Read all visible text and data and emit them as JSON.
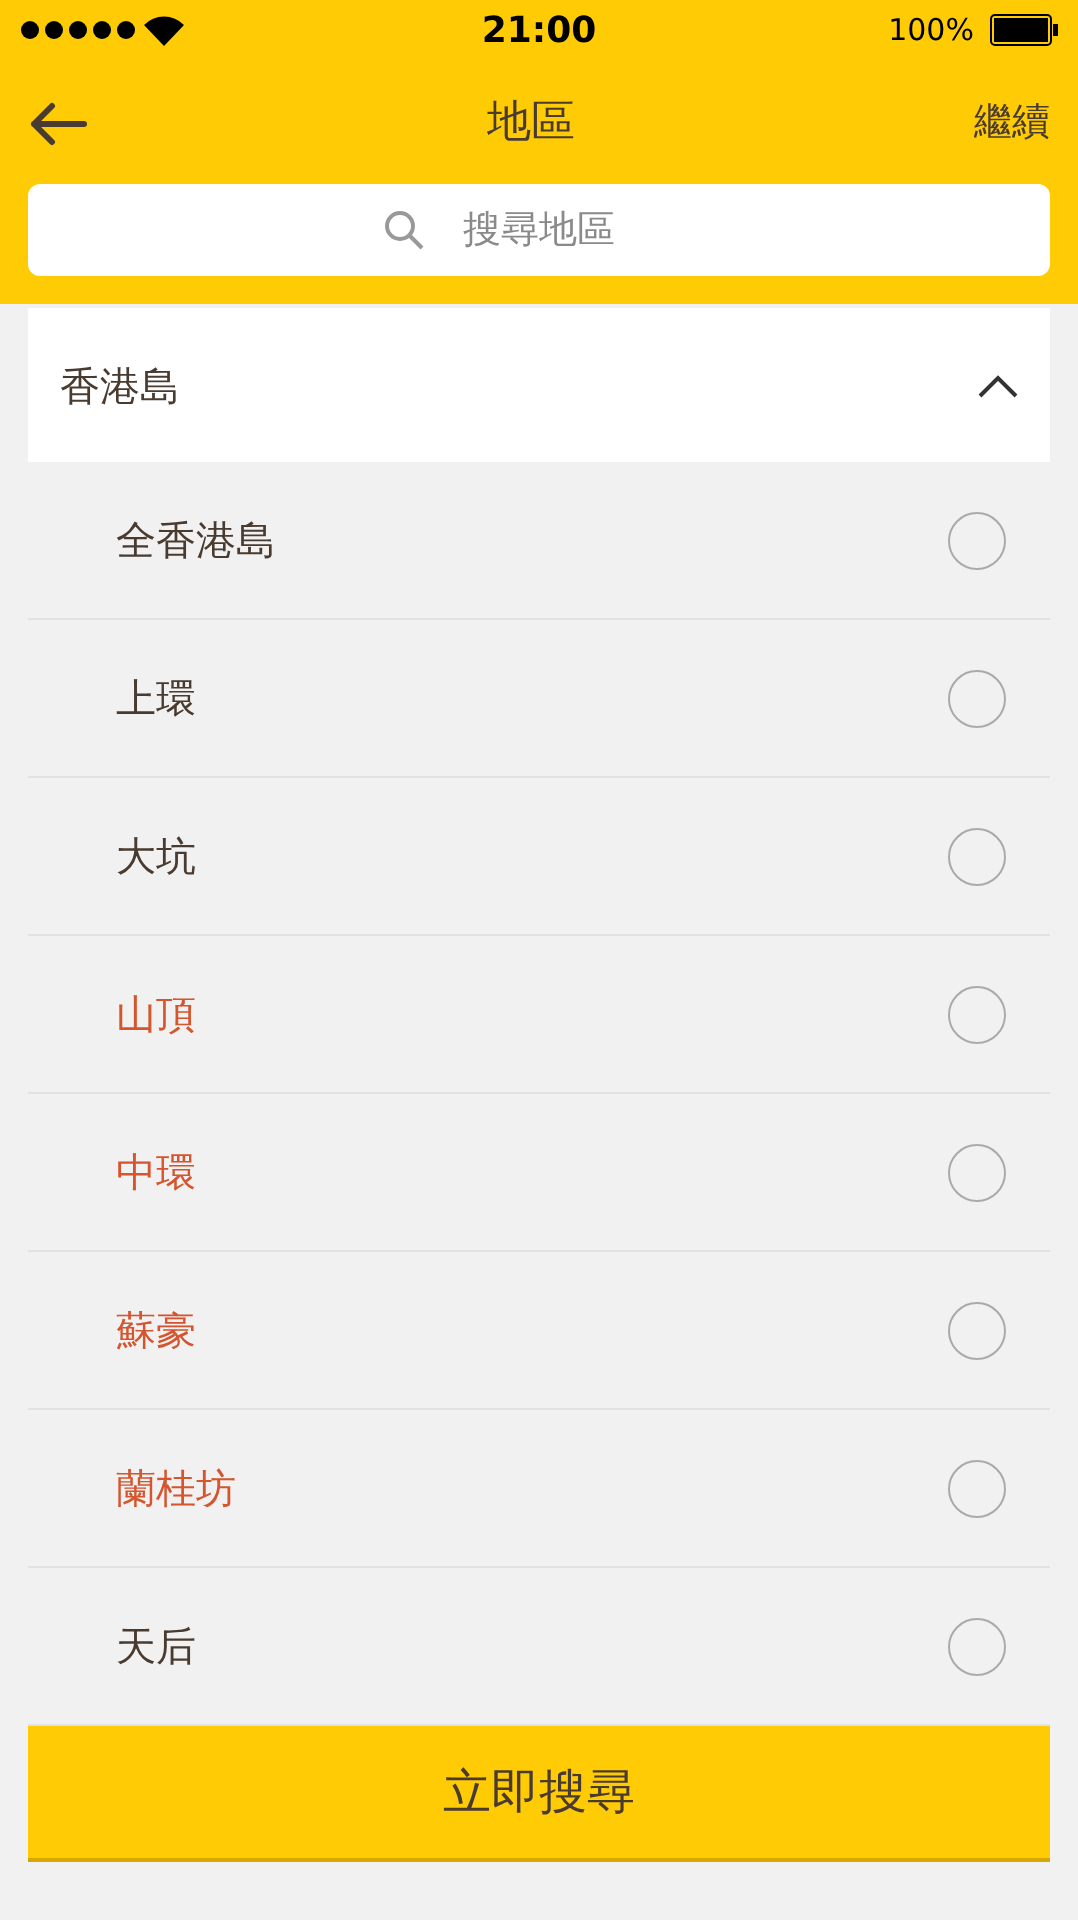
{
  "status_bar": {
    "time": "21:00",
    "battery": "100%"
  },
  "header": {
    "title": "地區",
    "action": "繼續"
  },
  "search": {
    "placeholder": "搜尋地區"
  },
  "section": {
    "title": "香港島",
    "expanded": true,
    "items": [
      {
        "label": "全香港島",
        "color": "#4a3b30",
        "selected": false
      },
      {
        "label": "上環",
        "color": "#4a3b30",
        "selected": false
      },
      {
        "label": "大坑",
        "color": "#4a3b30",
        "selected": false
      },
      {
        "label": "山頂",
        "color": "#d4552e",
        "selected": false
      },
      {
        "label": "中環",
        "color": "#d4552e",
        "selected": false
      },
      {
        "label": "蘇豪",
        "color": "#d4552e",
        "selected": false
      },
      {
        "label": "蘭桂坊",
        "color": "#d4552e",
        "selected": false
      },
      {
        "label": "天后",
        "color": "#4a3b30",
        "selected": false
      }
    ]
  },
  "button": {
    "label": "立即搜尋"
  }
}
